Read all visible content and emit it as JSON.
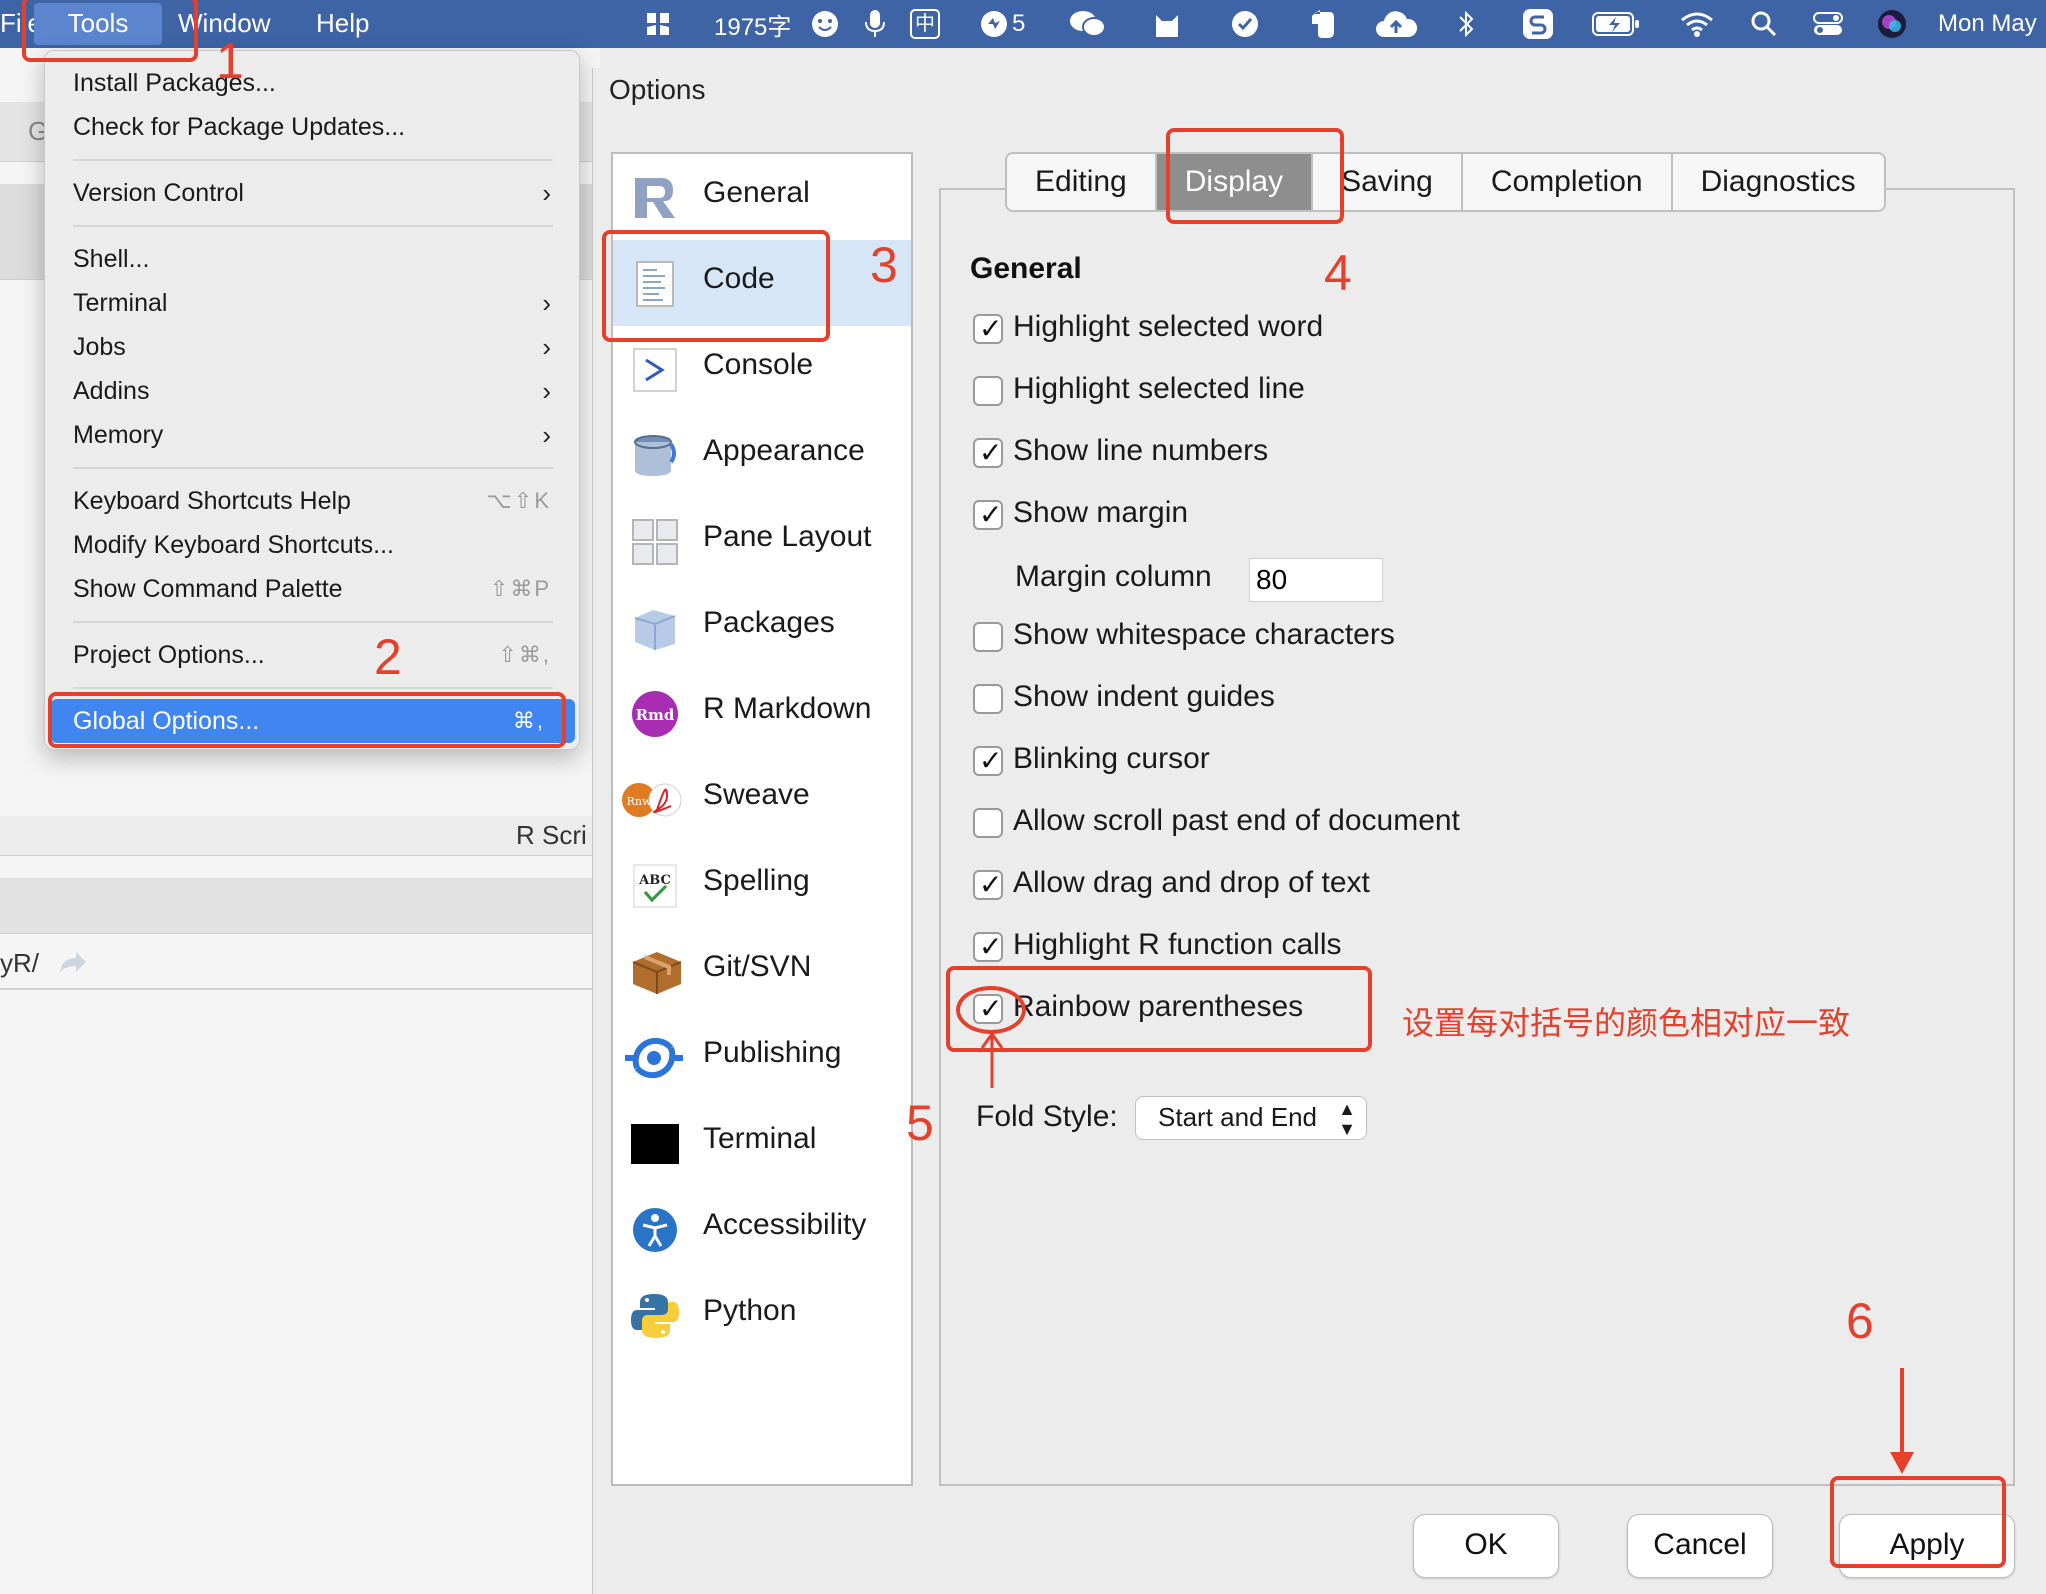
{
  "menubar": {
    "app_menu_fragment": "File",
    "tools": "Tools",
    "window": "Window",
    "help": "Help",
    "word_count": "1975字",
    "ime": "中",
    "notification_count": "5",
    "datetime_fragment": "Mon May"
  },
  "background_window": {
    "toolbar_fragment": "G",
    "tab_label": "R Scri",
    "path_fragment": "yR/"
  },
  "tools_menu": {
    "items": [
      {
        "label": "Install Packages..."
      },
      {
        "label": "Check for Package Updates..."
      },
      {
        "label": "Version Control",
        "submenu": true
      },
      {
        "label": "Shell..."
      },
      {
        "label": "Terminal",
        "submenu": true
      },
      {
        "label": "Jobs",
        "submenu": true
      },
      {
        "label": "Addins",
        "submenu": true
      },
      {
        "label": "Memory",
        "submenu": true
      },
      {
        "label": "Keyboard Shortcuts Help",
        "shortcut": "⌥⇧K"
      },
      {
        "label": "Modify Keyboard Shortcuts..."
      },
      {
        "label": "Show Command Palette",
        "shortcut": "⇧⌘P"
      },
      {
        "label": "Project Options...",
        "shortcut": "⇧⌘,"
      },
      {
        "label": "Global Options...",
        "shortcut": "⌘,",
        "selected": true
      }
    ]
  },
  "dialog": {
    "title": "Options",
    "categories": [
      {
        "label": "General",
        "icon": "r-logo-icon"
      },
      {
        "label": "Code",
        "icon": "code-document-icon",
        "selected": true
      },
      {
        "label": "Console",
        "icon": "console-prompt-icon"
      },
      {
        "label": "Appearance",
        "icon": "paint-bucket-icon"
      },
      {
        "label": "Pane Layout",
        "icon": "pane-grid-icon"
      },
      {
        "label": "Packages",
        "icon": "package-box-icon"
      },
      {
        "label": "R Markdown",
        "icon": "rmd-icon"
      },
      {
        "label": "Sweave",
        "icon": "sweave-icon"
      },
      {
        "label": "Spelling",
        "icon": "spelling-abc-icon"
      },
      {
        "label": "Git/SVN",
        "icon": "git-box-icon"
      },
      {
        "label": "Publishing",
        "icon": "publishing-icon"
      },
      {
        "label": "Terminal",
        "icon": "terminal-icon"
      },
      {
        "label": "Accessibility",
        "icon": "accessibility-icon"
      },
      {
        "label": "Python",
        "icon": "python-icon"
      }
    ],
    "tabs": [
      {
        "label": "Editing"
      },
      {
        "label": "Display",
        "selected": true
      },
      {
        "label": "Saving"
      },
      {
        "label": "Completion"
      },
      {
        "label": "Diagnostics"
      }
    ],
    "section_title": "General",
    "options": [
      {
        "label": "Highlight selected word",
        "checked": true
      },
      {
        "label": "Highlight selected line",
        "checked": false
      },
      {
        "label": "Show line numbers",
        "checked": true
      },
      {
        "label": "Show margin",
        "checked": true
      },
      {
        "label": "Show whitespace characters",
        "checked": false
      },
      {
        "label": "Show indent guides",
        "checked": false
      },
      {
        "label": "Blinking cursor",
        "checked": true
      },
      {
        "label": "Allow scroll past end of document",
        "checked": false
      },
      {
        "label": "Allow drag and drop of text",
        "checked": true
      },
      {
        "label": "Highlight R function calls",
        "checked": true
      },
      {
        "label": "Rainbow parentheses",
        "checked": true
      }
    ],
    "margin_column_label": "Margin column",
    "margin_column_value": "80",
    "fold_style_label": "Fold Style:",
    "fold_style_value": "Start and End",
    "buttons": {
      "ok": "OK",
      "cancel": "Cancel",
      "apply": "Apply"
    }
  },
  "annotations": {
    "color": "#e5402c",
    "numbers": [
      "1",
      "2",
      "3",
      "4",
      "5",
      "6"
    ],
    "note": "设置每对括号的颜色相对应一致"
  }
}
